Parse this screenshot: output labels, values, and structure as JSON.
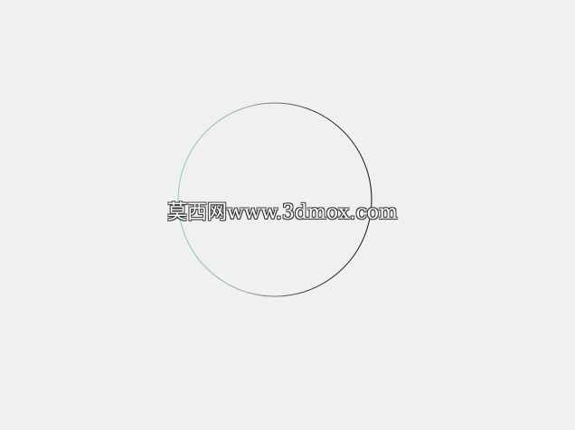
{
  "background_color": "#f0f0f0",
  "circle": {
    "stroke_colors": [
      "#3a3a3a",
      "#7fd0c8",
      "#111111"
    ]
  },
  "watermark": {
    "text": "莫西网www.3dmox.com",
    "color": "#ffffff",
    "outline_color": "#3a3a3a"
  }
}
